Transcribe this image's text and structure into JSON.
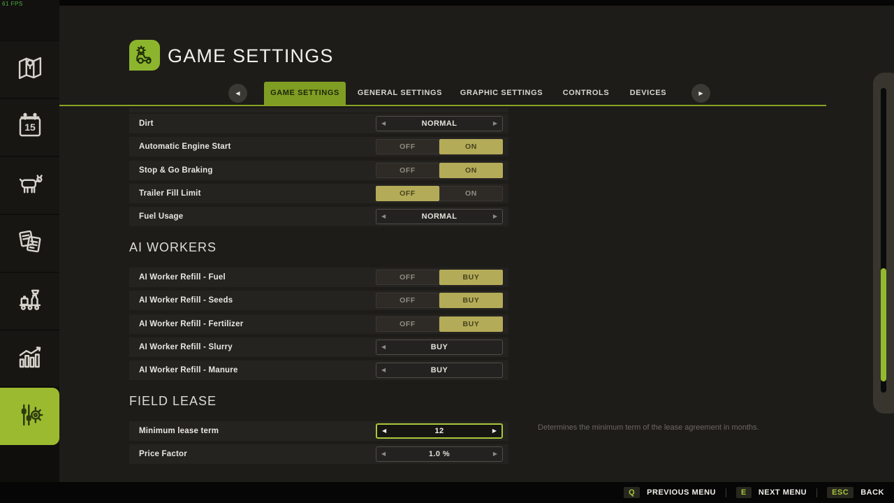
{
  "fps_counter": "61 FPS",
  "icons": {
    "arrow_left": "◀",
    "arrow_right": "▶"
  },
  "colors": {
    "accent_green": "#9cba2f",
    "tab_active_green": "#7f9d23",
    "option_active_khaki": "#b3ab58",
    "focus_border_green": "#a9c83a",
    "scroll_thumb_green": "#94bb2d"
  },
  "header": {
    "title": "GAME SETTINGS"
  },
  "tabs": {
    "items": [
      "GAME SETTINGS",
      "GENERAL SETTINGS",
      "GRAPHIC SETTINGS",
      "CONTROLS",
      "DEVICES"
    ],
    "active": "GAME SETTINGS"
  },
  "sidebar": {
    "items": [
      "map",
      "calendar",
      "animals",
      "contracts",
      "production",
      "statistics",
      "game-settings"
    ],
    "active": "game-settings"
  },
  "groups": [
    {
      "heading": "",
      "rows": [
        {
          "label": "Dirt",
          "type": "selector",
          "value": "NORMAL"
        },
        {
          "label": "Automatic Engine Start",
          "type": "toggle",
          "off": "OFF",
          "on": "ON",
          "selected": "ON"
        },
        {
          "label": "Stop & Go Braking",
          "type": "toggle",
          "off": "OFF",
          "on": "ON",
          "selected": "ON"
        },
        {
          "label": "Trailer Fill Limit",
          "type": "toggle",
          "off": "OFF",
          "on": "ON",
          "selected": "OFF"
        },
        {
          "label": "Fuel Usage",
          "type": "selector",
          "value": "NORMAL"
        }
      ]
    },
    {
      "heading": "AI WORKERS",
      "rows": [
        {
          "label": "AI Worker Refill - Fuel",
          "type": "toggle",
          "off": "OFF",
          "on": "BUY",
          "selected": "BUY"
        },
        {
          "label": "AI Worker Refill - Seeds",
          "type": "toggle",
          "off": "OFF",
          "on": "BUY",
          "selected": "BUY"
        },
        {
          "label": "AI Worker Refill - Fertilizer",
          "type": "toggle",
          "off": "OFF",
          "on": "BUY",
          "selected": "BUY"
        },
        {
          "label": "AI Worker Refill - Slurry",
          "type": "selector",
          "value": "BUY"
        },
        {
          "label": "AI Worker Refill - Manure",
          "type": "selector",
          "value": "BUY"
        }
      ]
    },
    {
      "heading": "FIELD LEASE",
      "rows": [
        {
          "label": "Minimum lease term",
          "type": "selector",
          "value": "12",
          "focused": true
        },
        {
          "label": "Price Factor",
          "type": "selector",
          "value": "1.0 %"
        }
      ]
    }
  ],
  "description": "Determines the minimum term of the lease agreement in months.",
  "footer": {
    "items": [
      {
        "key": "Q",
        "label": "PREVIOUS MENU"
      },
      {
        "key": "E",
        "label": "NEXT MENU"
      },
      {
        "key": "ESC",
        "label": "BACK"
      }
    ]
  }
}
